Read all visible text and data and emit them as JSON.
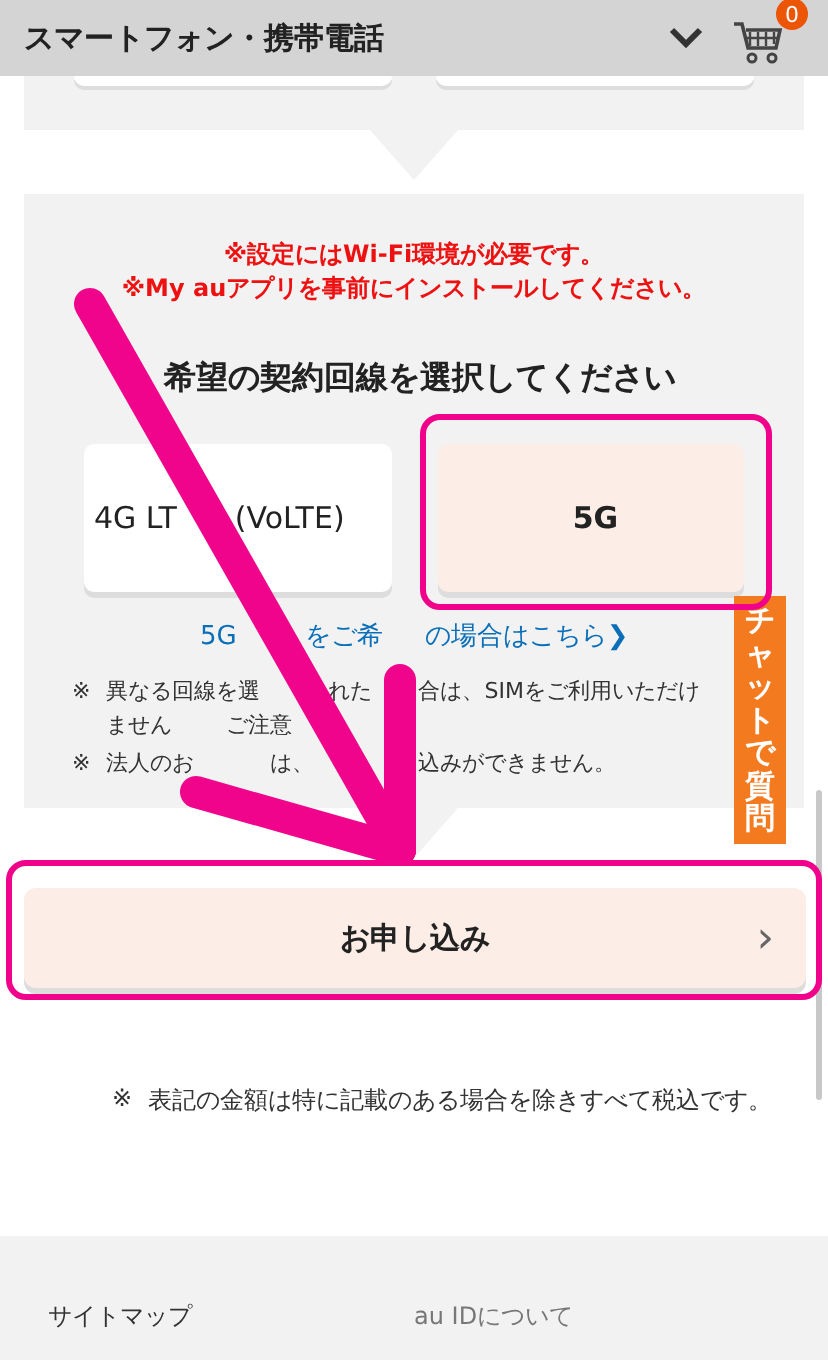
{
  "header": {
    "title": "スマートフォン・携帯電話",
    "cart_count": "0"
  },
  "notice": [
    "※設定にはWi-Fi環境が必要です。",
    "※My auアプリを事前にインストールしてください。"
  ],
  "heading": "希望の契約回線を選択してください",
  "options": [
    {
      "parts": [
        "4G LT",
        "(VoLTE)"
      ],
      "selected": false
    },
    {
      "parts": [
        "5G"
      ],
      "selected": true
    }
  ],
  "link": {
    "parts": [
      "5G",
      "をご希",
      "の場合はこちら"
    ],
    "arrow": "❯"
  },
  "notes": [
    {
      "mark": "※",
      "lines": [
        [
          "異なる回線を選",
          "れた",
          "合は、SIMをご利用いただけ"
        ],
        [
          "ません",
          "ご注意"
        ]
      ]
    },
    {
      "mark": "※",
      "lines": [
        [
          "法人のお",
          "は、",
          "込みができません。"
        ]
      ]
    }
  ],
  "chat_tab": "チャットで質問",
  "apply_button": {
    "label": "お申し込み",
    "chevron": "›"
  },
  "tax_note": {
    "mark": "※",
    "text": "表記の金額は特に記載のある場合を除きすべて税込です。"
  },
  "footer": [
    "サイトマップ",
    "au IDについて"
  ]
}
